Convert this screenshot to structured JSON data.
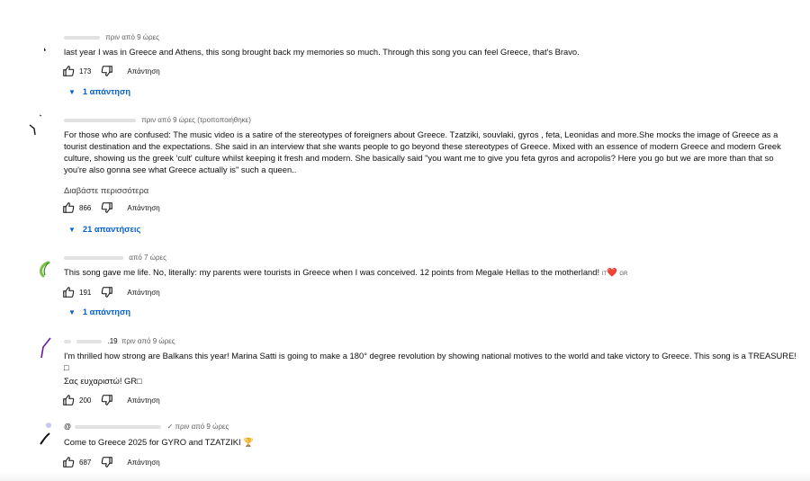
{
  "comments": [
    {
      "handle": "",
      "time": "πριν από 9 ώρες",
      "text": "last year I was in Greece and Athens, this song brought back my memories so much. Through this song you can feel Greece, that's Bravo.",
      "likes": "173",
      "reply_label": "Απάντηση",
      "replies_label": "1 απάντηση"
    },
    {
      "handle": "",
      "time": "πριν από 9 ώρες (τροποποιήθηκε)",
      "text": "For those who are confused: The music video is a satire of the stereotypes of foreigners about  Greece. Tzatziki, souvlaki, gyros , feta, Leonidas and more.She mocks the image of Greece as a tourist destination and the expectations. She said in an interview that she wants people to go beyond these stereotypes of Greece. Mixed with an essence of modern Greece and modern Greek culture, showing us the greek 'cult' culture whilst keeping it fresh and modern. She basically said \"you want me to give you feta gyros and acropolis? Here you go but we are more than that so you're also gonna see what Greece actually is\" such a queen..",
      "read_more": "Διαβάστε περισσότερα",
      "likes": "866",
      "reply_label": "Απάντηση",
      "replies_label": "21 απαντήσεις"
    },
    {
      "handle": "",
      "time": "από 7 ώρες",
      "text": "This song gave me life. No, literally: my parents were tourists in Greece when I was conceived. 12 points from Megale Hellas to the motherland!",
      "text_suffix_code": "IT",
      "text_heart": "❤️",
      "text_suffix_flag": "GR",
      "likes": "191",
      "reply_label": "Απάντηση",
      "replies_label": "1 απάντηση"
    },
    {
      "handle": ".19",
      "time": "πριν από 9 ώρες",
      "text": "I'm thrilled how strong are Balkans this year! Marina Satti is going to make a 180° degree revolution by showing national motives to the world and take victory to Greece. This song is a TREASURE! □",
      "text_line2": "Σας ευχαριστώ! GR□",
      "likes": "200",
      "reply_label": "Απάντηση"
    },
    {
      "handle": "@",
      "time": "✓ πριν από 9 ώρες",
      "text": "Come to Greece 2025 for GYRO and TZATZIKI",
      "text_emoji": "🏆",
      "likes": "687",
      "reply_label": "Απάντηση"
    }
  ],
  "icons": {
    "like": "thumbs-up-icon",
    "dislike": "thumbs-down-icon",
    "expand": "chevron-down-icon"
  },
  "colors": {
    "link_blue": "#065fd4",
    "meta_gray": "#606060",
    "text": "#0f0f0f"
  }
}
